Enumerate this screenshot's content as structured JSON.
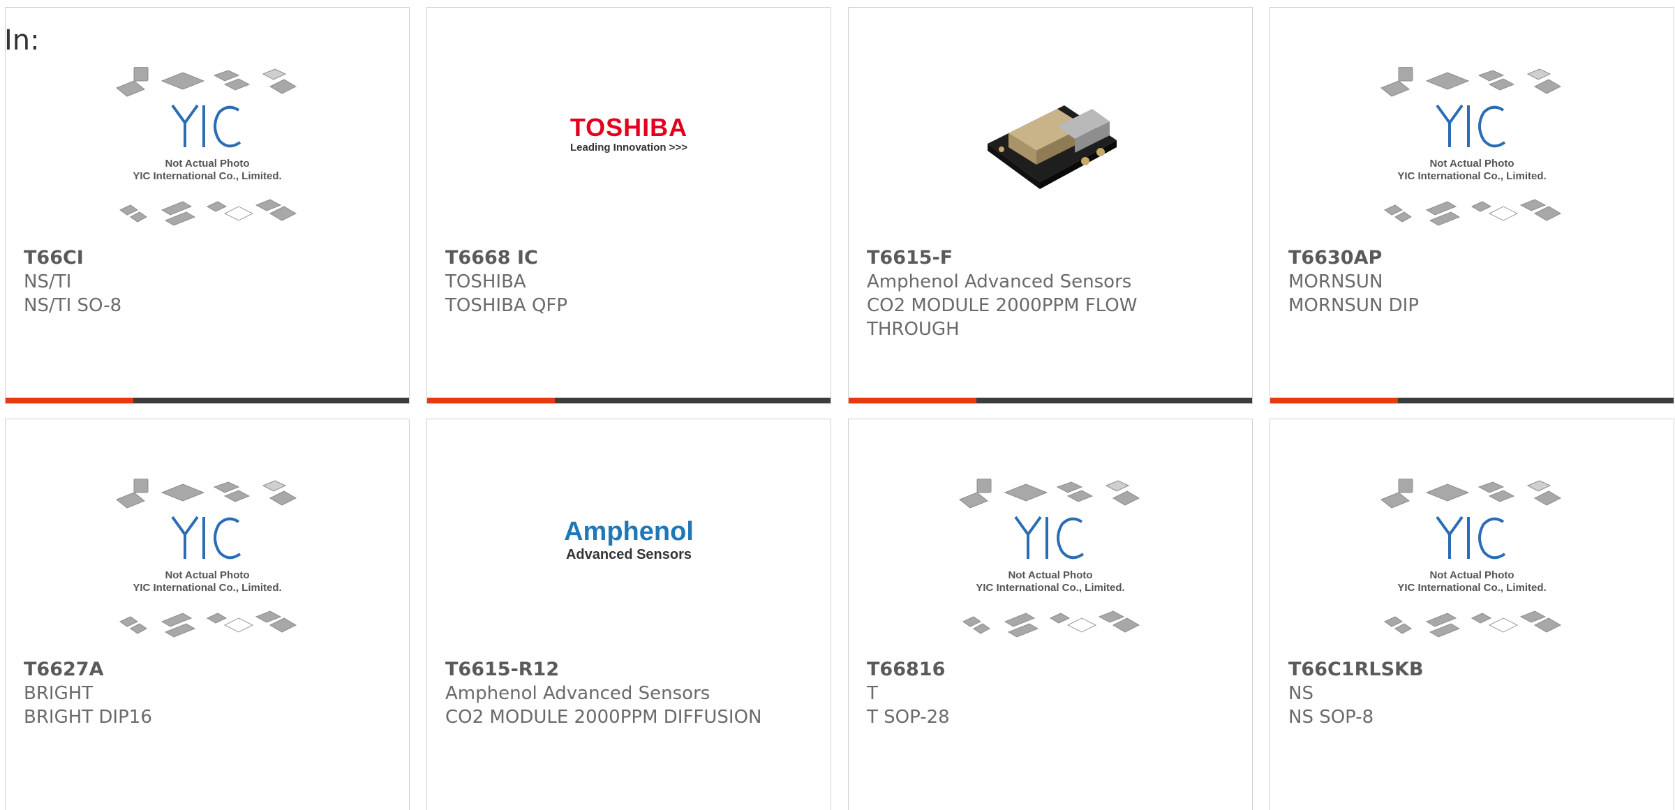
{
  "header": {
    "in_label": "In:"
  },
  "placeholder": {
    "line1": "Not Actual Photo",
    "line2": "YIC International Co., Limited.",
    "logo_text": "YIC"
  },
  "logos": {
    "toshiba": {
      "name": "TOSHIBA",
      "tagline": "Leading Innovation >>>"
    },
    "amphenol": {
      "name": "Amphenol",
      "tagline": "Advanced Sensors"
    }
  },
  "colors": {
    "accent": "#e33a12",
    "bar": "#3c3c3c",
    "yic_blue": "#2a6db5"
  },
  "products": [
    {
      "part": "T66CI",
      "manufacturer": "NS/TI",
      "description": "NS/TI SO-8",
      "image": "placeholder"
    },
    {
      "part": "T6668 IC",
      "manufacturer": "TOSHIBA",
      "description": "TOSHIBA QFP",
      "image": "toshiba-logo"
    },
    {
      "part": "T6615-F",
      "manufacturer": "Amphenol Advanced Sensors",
      "description": "CO2 MODULE 2000PPM FLOW THROUGH",
      "image": "sensor-photo"
    },
    {
      "part": "T6630AP",
      "manufacturer": "MORNSUN",
      "description": "MORNSUN DIP",
      "image": "placeholder"
    },
    {
      "part": "T6627A",
      "manufacturer": "BRIGHT",
      "description": "BRIGHT DIP16",
      "image": "placeholder"
    },
    {
      "part": "T6615-R12",
      "manufacturer": "Amphenol Advanced Sensors",
      "description": "CO2 MODULE 2000PPM DIFFUSION",
      "image": "amphenol-logo"
    },
    {
      "part": "T66816",
      "manufacturer": "T",
      "description": "T SOP-28",
      "image": "placeholder"
    },
    {
      "part": "T66C1RLSKB",
      "manufacturer": "NS",
      "description": "NS SOP-8",
      "image": "placeholder"
    }
  ]
}
